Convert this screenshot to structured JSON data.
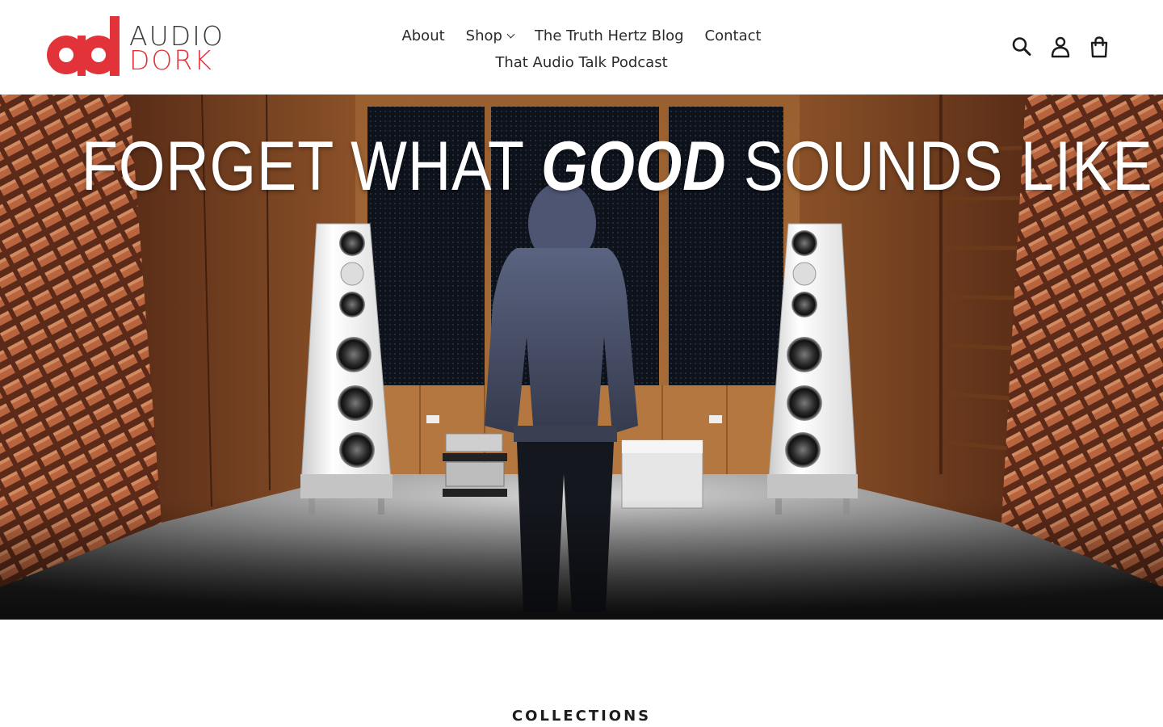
{
  "brand": {
    "line1": "AUDIO",
    "line2": "DORK",
    "accent_color": "#e3333a"
  },
  "nav": {
    "items": [
      {
        "label": "About"
      },
      {
        "label": "Shop",
        "has_dropdown": true
      },
      {
        "label": "The Truth Hertz Blog"
      },
      {
        "label": "Contact"
      },
      {
        "label": "That Audio Talk Podcast"
      }
    ]
  },
  "header_icons": [
    "search-icon",
    "account-icon",
    "cart-icon"
  ],
  "hero": {
    "headline_before": "FORGET WHAT ",
    "headline_emphasis": "GOOD",
    "headline_after": " SOUNDS LIKE"
  },
  "collections": {
    "title": "COLLECTIONS"
  }
}
